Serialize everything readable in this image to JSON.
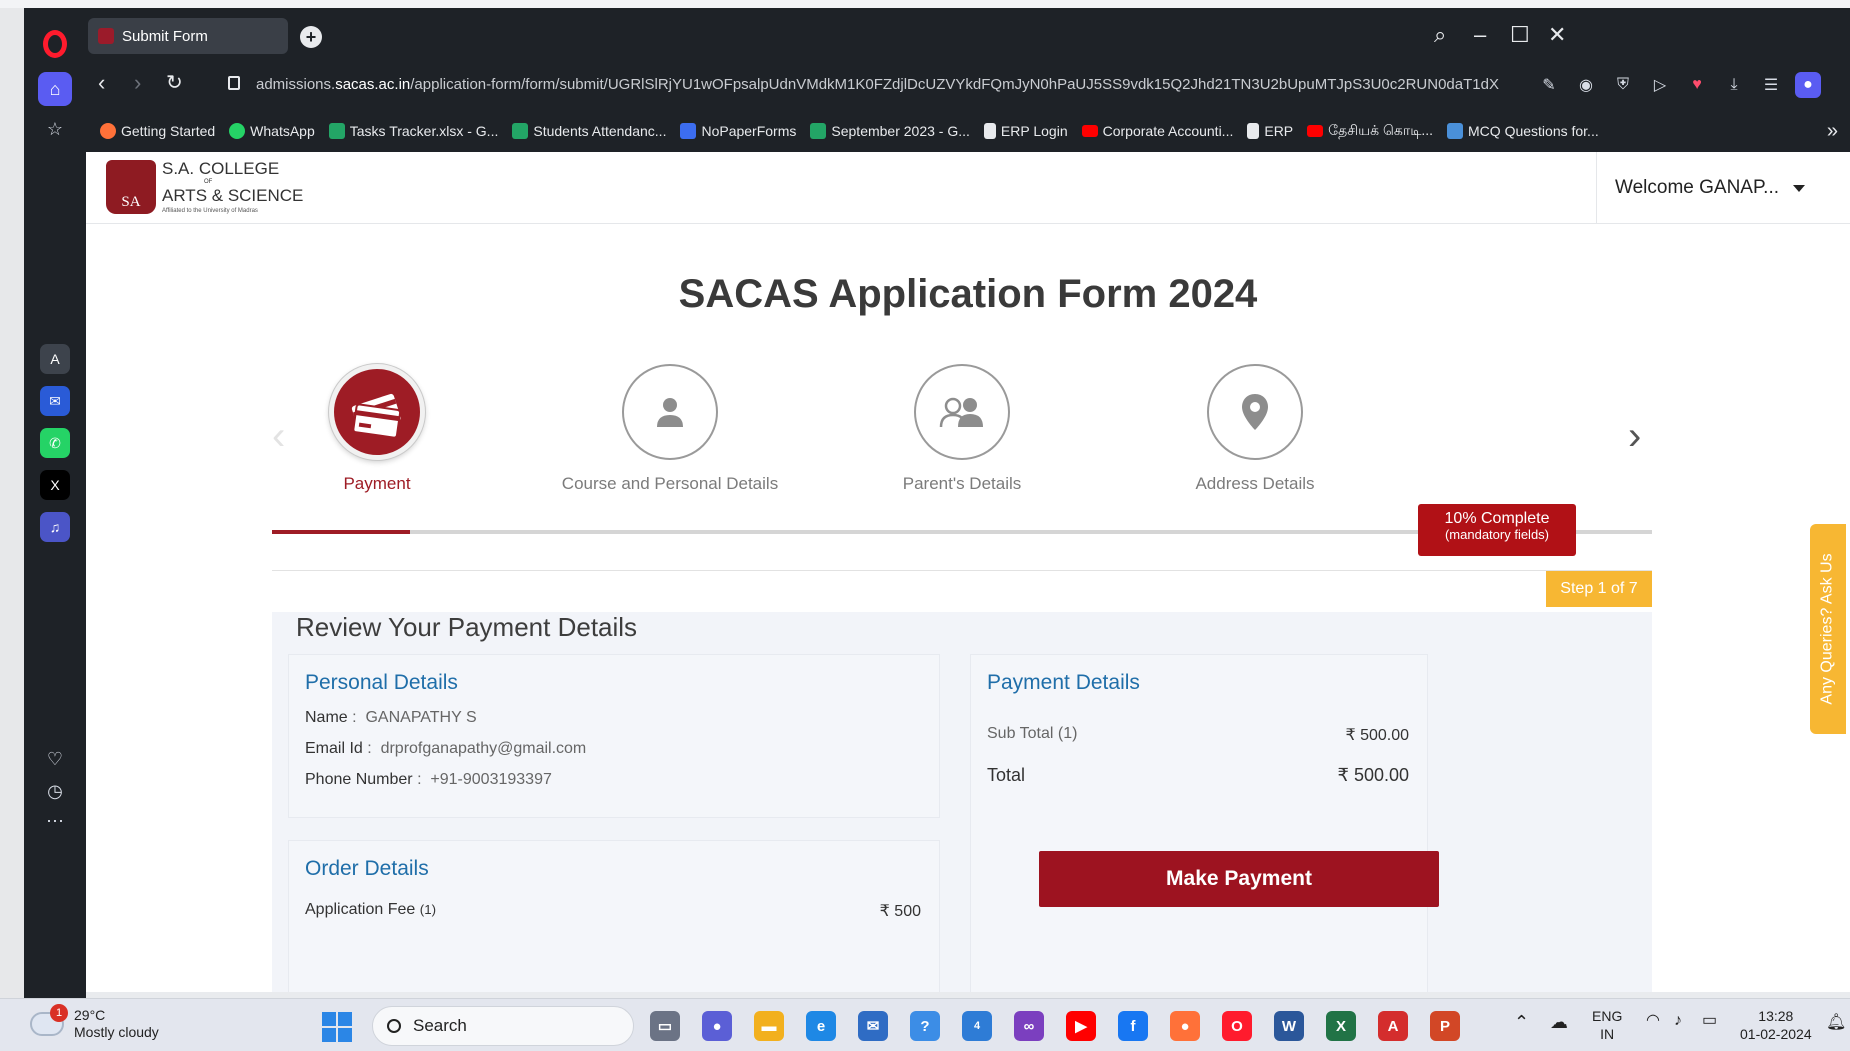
{
  "browser": {
    "tab_title": "Submit Form",
    "url_prefix": "admissions.",
    "url_domain": "sacas.ac.in",
    "url_path": "/application-form/form/submit/UGRlSlRjYU1wOFpsalpUdnVMdkM1K0FZdjlDcUZVYkdFQmJyN0hPaUJ5SS9vdk15Q2Jhd21TN3U2bUpuMTJpS3U0c2RUN0daT1dX",
    "bookmarks": [
      {
        "label": "Getting Started",
        "icon": "firefox-icon",
        "color": "#ff7139"
      },
      {
        "label": "WhatsApp",
        "icon": "whatsapp-icon",
        "color": "#25d366"
      },
      {
        "label": "Tasks Tracker.xlsx - G...",
        "icon": "sheets-icon",
        "color": "#23a566"
      },
      {
        "label": "Students Attendanc...",
        "icon": "sheets-icon",
        "color": "#23a566"
      },
      {
        "label": "NoPaperForms",
        "icon": "npf-icon",
        "color": "#3c6df0"
      },
      {
        "label": "September 2023 - G...",
        "icon": "sheets-icon",
        "color": "#23a566"
      },
      {
        "label": "ERP Login",
        "icon": "page-icon",
        "color": "#e8eaed"
      },
      {
        "label": "Corporate Accounti...",
        "icon": "youtube-icon",
        "color": "#ff0000"
      },
      {
        "label": "ERP",
        "icon": "page-icon",
        "color": "#e8eaed"
      },
      {
        "label": "தேசியக் கொடி...",
        "icon": "youtube-icon",
        "color": "#ff0000"
      },
      {
        "label": "MCQ Questions for...",
        "icon": "mcq-icon",
        "color": "#4a90d9"
      }
    ]
  },
  "site": {
    "college_line1": "S.A. COLLEGE",
    "college_of": "OF",
    "college_line2": "ARTS & SCIENCE",
    "college_sub": "Affiliated to the University of Madras",
    "logo_text": "SA",
    "welcome": "Welcome GANAP..."
  },
  "form": {
    "title": "SACAS Application Form 2024",
    "steps": [
      {
        "label": "Payment",
        "active": true
      },
      {
        "label": "Course and Personal Details",
        "active": false
      },
      {
        "label": "Parent's Details",
        "active": false
      },
      {
        "label": "Address Details",
        "active": false
      }
    ],
    "progress_percent": 10,
    "complete_text": "10% Complete",
    "complete_sub": "(mandatory fields)",
    "step_count": "Step 1 of 7",
    "review_title": "Review Your Payment Details",
    "ask_queries": "Any Queries? Ask Us"
  },
  "personal": {
    "title": "Personal Details",
    "name_label": "Name",
    "name_value": "GANAPATHY S",
    "email_label": "Email Id",
    "email_value": "drprofganapathy@gmail.com",
    "phone_label": "Phone Number",
    "phone_value": "+91-9003193397"
  },
  "order": {
    "title": "Order Details",
    "item_label": "Application Fee",
    "item_qty": "(1)",
    "item_amount": "₹ 500"
  },
  "payment": {
    "title": "Payment Details",
    "subtotal_label": "Sub Total (1)",
    "subtotal_value": "₹  500.00",
    "total_label": "Total",
    "total_value": "₹  500.00",
    "button_label": "Make Payment"
  },
  "taskbar": {
    "weather_badge": "1",
    "temperature": "29°C",
    "weather_desc": "Mostly cloudy",
    "search_label": "Search",
    "lang_line1": "ENG",
    "lang_line2": "IN",
    "time": "13:28",
    "date": "01-02-2024",
    "notification_count": "4"
  },
  "colors": {
    "brand": "#9e1c25",
    "accent_link": "#1f6ea9",
    "warning": "#f7b733"
  }
}
